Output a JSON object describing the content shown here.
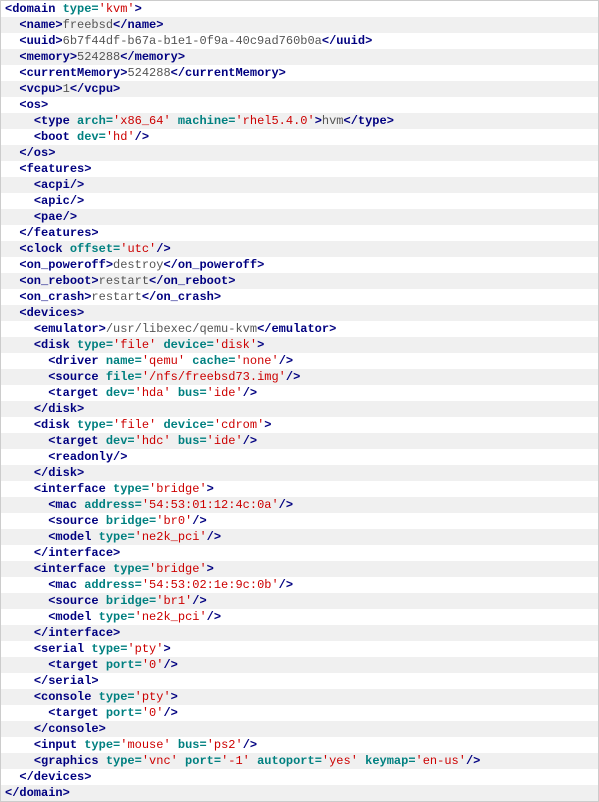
{
  "i1": "  ",
  "i2": "    ",
  "i3": "      ",
  "lines": [
    {
      "i": 0,
      "p": [
        {
          "t": "tag",
          "v": "<domain "
        },
        {
          "t": "attr",
          "v": "type="
        },
        {
          "t": "val",
          "v": "'kvm'"
        },
        {
          "t": "tag",
          "v": ">"
        }
      ]
    },
    {
      "i": 1,
      "p": [
        {
          "t": "tag",
          "v": "<name>"
        },
        {
          "t": "txt",
          "v": "freebsd"
        },
        {
          "t": "tag",
          "v": "</name>"
        }
      ]
    },
    {
      "i": 1,
      "p": [
        {
          "t": "tag",
          "v": "<uuid>"
        },
        {
          "t": "txt",
          "v": "6b7f44df-b67a-b1e1-0f9a-40c9ad760b0a"
        },
        {
          "t": "tag",
          "v": "</uuid>"
        }
      ]
    },
    {
      "i": 1,
      "p": [
        {
          "t": "tag",
          "v": "<memory>"
        },
        {
          "t": "txt",
          "v": "524288"
        },
        {
          "t": "tag",
          "v": "</memory>"
        }
      ]
    },
    {
      "i": 1,
      "p": [
        {
          "t": "tag",
          "v": "<currentMemory>"
        },
        {
          "t": "txt",
          "v": "524288"
        },
        {
          "t": "tag",
          "v": "</currentMemory>"
        }
      ]
    },
    {
      "i": 1,
      "p": [
        {
          "t": "tag",
          "v": "<vcpu>"
        },
        {
          "t": "txt",
          "v": "1"
        },
        {
          "t": "tag",
          "v": "</vcpu>"
        }
      ]
    },
    {
      "i": 1,
      "p": [
        {
          "t": "tag",
          "v": "<os>"
        }
      ]
    },
    {
      "i": 2,
      "p": [
        {
          "t": "tag",
          "v": "<type "
        },
        {
          "t": "attr",
          "v": "arch="
        },
        {
          "t": "val",
          "v": "'x86_64'"
        },
        {
          "t": "attr",
          "v": " machine="
        },
        {
          "t": "val",
          "v": "'rhel5.4.0'"
        },
        {
          "t": "tag",
          "v": ">"
        },
        {
          "t": "txt",
          "v": "hvm"
        },
        {
          "t": "tag",
          "v": "</type>"
        }
      ]
    },
    {
      "i": 2,
      "p": [
        {
          "t": "tag",
          "v": "<boot "
        },
        {
          "t": "attr",
          "v": "dev="
        },
        {
          "t": "val",
          "v": "'hd'"
        },
        {
          "t": "tag",
          "v": "/>"
        }
      ]
    },
    {
      "i": 1,
      "p": [
        {
          "t": "tag",
          "v": "</os>"
        }
      ]
    },
    {
      "i": 1,
      "p": [
        {
          "t": "tag",
          "v": "<features>"
        }
      ]
    },
    {
      "i": 2,
      "p": [
        {
          "t": "tag",
          "v": "<acpi/>"
        }
      ]
    },
    {
      "i": 2,
      "p": [
        {
          "t": "tag",
          "v": "<apic/>"
        }
      ]
    },
    {
      "i": 2,
      "p": [
        {
          "t": "tag",
          "v": "<pae/>"
        }
      ]
    },
    {
      "i": 1,
      "p": [
        {
          "t": "tag",
          "v": "</features>"
        }
      ]
    },
    {
      "i": 1,
      "p": [
        {
          "t": "tag",
          "v": "<clock "
        },
        {
          "t": "attr",
          "v": "offset="
        },
        {
          "t": "val",
          "v": "'utc'"
        },
        {
          "t": "tag",
          "v": "/>"
        }
      ]
    },
    {
      "i": 1,
      "p": [
        {
          "t": "tag",
          "v": "<on_poweroff>"
        },
        {
          "t": "txt",
          "v": "destroy"
        },
        {
          "t": "tag",
          "v": "</on_poweroff>"
        }
      ]
    },
    {
      "i": 1,
      "p": [
        {
          "t": "tag",
          "v": "<on_reboot>"
        },
        {
          "t": "txt",
          "v": "restart"
        },
        {
          "t": "tag",
          "v": "</on_reboot>"
        }
      ]
    },
    {
      "i": 1,
      "p": [
        {
          "t": "tag",
          "v": "<on_crash>"
        },
        {
          "t": "txt",
          "v": "restart"
        },
        {
          "t": "tag",
          "v": "</on_crash>"
        }
      ]
    },
    {
      "i": 1,
      "p": [
        {
          "t": "tag",
          "v": "<devices>"
        }
      ]
    },
    {
      "i": 2,
      "p": [
        {
          "t": "tag",
          "v": "<emulator>"
        },
        {
          "t": "txt",
          "v": "/usr/libexec/qemu-kvm"
        },
        {
          "t": "tag",
          "v": "</emulator>"
        }
      ]
    },
    {
      "i": 2,
      "p": [
        {
          "t": "tag",
          "v": "<disk "
        },
        {
          "t": "attr",
          "v": "type="
        },
        {
          "t": "val",
          "v": "'file'"
        },
        {
          "t": "attr",
          "v": " device="
        },
        {
          "t": "val",
          "v": "'disk'"
        },
        {
          "t": "tag",
          "v": ">"
        }
      ]
    },
    {
      "i": 3,
      "p": [
        {
          "t": "tag",
          "v": "<driver "
        },
        {
          "t": "attr",
          "v": "name="
        },
        {
          "t": "val",
          "v": "'qemu'"
        },
        {
          "t": "attr",
          "v": " cache="
        },
        {
          "t": "val",
          "v": "'none'"
        },
        {
          "t": "tag",
          "v": "/>"
        }
      ]
    },
    {
      "i": 3,
      "p": [
        {
          "t": "tag",
          "v": "<source "
        },
        {
          "t": "attr",
          "v": "file="
        },
        {
          "t": "val",
          "v": "'/nfs/freebsd73.img'"
        },
        {
          "t": "tag",
          "v": "/>"
        }
      ]
    },
    {
      "i": 3,
      "p": [
        {
          "t": "tag",
          "v": "<target "
        },
        {
          "t": "attr",
          "v": "dev="
        },
        {
          "t": "val",
          "v": "'hda'"
        },
        {
          "t": "attr",
          "v": " bus="
        },
        {
          "t": "val",
          "v": "'ide'"
        },
        {
          "t": "tag",
          "v": "/>"
        }
      ]
    },
    {
      "i": 2,
      "p": [
        {
          "t": "tag",
          "v": "</disk>"
        }
      ]
    },
    {
      "i": 2,
      "p": [
        {
          "t": "tag",
          "v": "<disk "
        },
        {
          "t": "attr",
          "v": "type="
        },
        {
          "t": "val",
          "v": "'file'"
        },
        {
          "t": "attr",
          "v": " device="
        },
        {
          "t": "val",
          "v": "'cdrom'"
        },
        {
          "t": "tag",
          "v": ">"
        }
      ]
    },
    {
      "i": 3,
      "p": [
        {
          "t": "tag",
          "v": "<target "
        },
        {
          "t": "attr",
          "v": "dev="
        },
        {
          "t": "val",
          "v": "'hdc'"
        },
        {
          "t": "attr",
          "v": " bus="
        },
        {
          "t": "val",
          "v": "'ide'"
        },
        {
          "t": "tag",
          "v": "/>"
        }
      ]
    },
    {
      "i": 3,
      "p": [
        {
          "t": "tag",
          "v": "<readonly/>"
        }
      ]
    },
    {
      "i": 2,
      "p": [
        {
          "t": "tag",
          "v": "</disk>"
        }
      ]
    },
    {
      "i": 2,
      "p": [
        {
          "t": "tag",
          "v": "<interface "
        },
        {
          "t": "attr",
          "v": "type="
        },
        {
          "t": "val",
          "v": "'bridge'"
        },
        {
          "t": "tag",
          "v": ">"
        }
      ]
    },
    {
      "i": 3,
      "p": [
        {
          "t": "tag",
          "v": "<mac "
        },
        {
          "t": "attr",
          "v": "address="
        },
        {
          "t": "val",
          "v": "'54:53:01:12:4c:0a'"
        },
        {
          "t": "tag",
          "v": "/>"
        }
      ]
    },
    {
      "i": 3,
      "p": [
        {
          "t": "tag",
          "v": "<source "
        },
        {
          "t": "attr",
          "v": "bridge="
        },
        {
          "t": "val",
          "v": "'br0'"
        },
        {
          "t": "tag",
          "v": "/>"
        }
      ]
    },
    {
      "i": 3,
      "p": [
        {
          "t": "tag",
          "v": "<model "
        },
        {
          "t": "attr",
          "v": "type="
        },
        {
          "t": "val",
          "v": "'ne2k_pci'"
        },
        {
          "t": "tag",
          "v": "/>"
        }
      ]
    },
    {
      "i": 2,
      "p": [
        {
          "t": "tag",
          "v": "</interface>"
        }
      ]
    },
    {
      "i": 2,
      "p": [
        {
          "t": "tag",
          "v": "<interface "
        },
        {
          "t": "attr",
          "v": "type="
        },
        {
          "t": "val",
          "v": "'bridge'"
        },
        {
          "t": "tag",
          "v": ">"
        }
      ]
    },
    {
      "i": 3,
      "p": [
        {
          "t": "tag",
          "v": "<mac "
        },
        {
          "t": "attr",
          "v": "address="
        },
        {
          "t": "val",
          "v": "'54:53:02:1e:9c:0b'"
        },
        {
          "t": "tag",
          "v": "/>"
        }
      ]
    },
    {
      "i": 3,
      "p": [
        {
          "t": "tag",
          "v": "<source "
        },
        {
          "t": "attr",
          "v": "bridge="
        },
        {
          "t": "val",
          "v": "'br1'"
        },
        {
          "t": "tag",
          "v": "/>"
        }
      ]
    },
    {
      "i": 3,
      "p": [
        {
          "t": "tag",
          "v": "<model "
        },
        {
          "t": "attr",
          "v": "type="
        },
        {
          "t": "val",
          "v": "'ne2k_pci'"
        },
        {
          "t": "tag",
          "v": "/>"
        }
      ]
    },
    {
      "i": 2,
      "p": [
        {
          "t": "tag",
          "v": "</interface>"
        }
      ]
    },
    {
      "i": 2,
      "p": [
        {
          "t": "tag",
          "v": "<serial "
        },
        {
          "t": "attr",
          "v": "type="
        },
        {
          "t": "val",
          "v": "'pty'"
        },
        {
          "t": "tag",
          "v": ">"
        }
      ]
    },
    {
      "i": 3,
      "p": [
        {
          "t": "tag",
          "v": "<target "
        },
        {
          "t": "attr",
          "v": "port="
        },
        {
          "t": "val",
          "v": "'0'"
        },
        {
          "t": "tag",
          "v": "/>"
        }
      ]
    },
    {
      "i": 2,
      "p": [
        {
          "t": "tag",
          "v": "</serial>"
        }
      ]
    },
    {
      "i": 2,
      "p": [
        {
          "t": "tag",
          "v": "<console "
        },
        {
          "t": "attr",
          "v": "type="
        },
        {
          "t": "val",
          "v": "'pty'"
        },
        {
          "t": "tag",
          "v": ">"
        }
      ]
    },
    {
      "i": 3,
      "p": [
        {
          "t": "tag",
          "v": "<target "
        },
        {
          "t": "attr",
          "v": "port="
        },
        {
          "t": "val",
          "v": "'0'"
        },
        {
          "t": "tag",
          "v": "/>"
        }
      ]
    },
    {
      "i": 2,
      "p": [
        {
          "t": "tag",
          "v": "</console>"
        }
      ]
    },
    {
      "i": 2,
      "p": [
        {
          "t": "tag",
          "v": "<input "
        },
        {
          "t": "attr",
          "v": "type="
        },
        {
          "t": "val",
          "v": "'mouse'"
        },
        {
          "t": "attr",
          "v": " bus="
        },
        {
          "t": "val",
          "v": "'ps2'"
        },
        {
          "t": "tag",
          "v": "/>"
        }
      ]
    },
    {
      "i": 2,
      "p": [
        {
          "t": "tag",
          "v": "<graphics "
        },
        {
          "t": "attr",
          "v": "type="
        },
        {
          "t": "val",
          "v": "'vnc'"
        },
        {
          "t": "attr",
          "v": " port="
        },
        {
          "t": "val",
          "v": "'-1'"
        },
        {
          "t": "attr",
          "v": " autoport="
        },
        {
          "t": "val",
          "v": "'yes'"
        },
        {
          "t": "attr",
          "v": " keymap="
        },
        {
          "t": "val",
          "v": "'en-us'"
        },
        {
          "t": "tag",
          "v": "/>"
        }
      ]
    },
    {
      "i": 1,
      "p": [
        {
          "t": "tag",
          "v": "</devices>"
        }
      ]
    },
    {
      "i": 0,
      "p": [
        {
          "t": "tag",
          "v": "</domain>"
        }
      ]
    }
  ]
}
